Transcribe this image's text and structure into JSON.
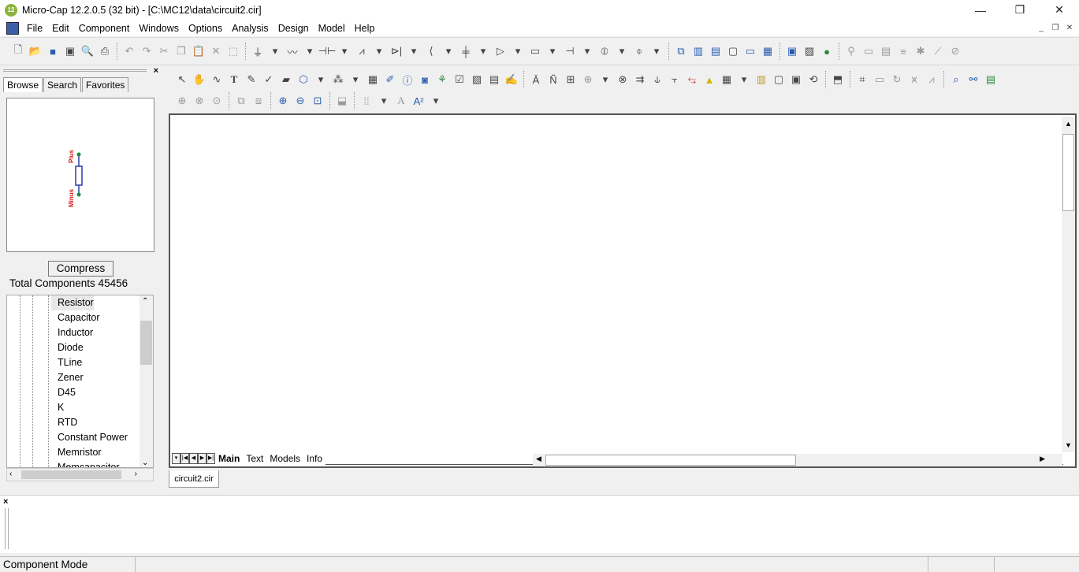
{
  "window": {
    "title": "Micro-Cap 12.2.0.5 (32 bit) - [C:\\MC12\\data\\circuit2.cir]",
    "app_icon_text": "12",
    "minimize": "—",
    "restore": "❐",
    "close": "✕"
  },
  "menu": {
    "items": [
      "File",
      "Edit",
      "Component",
      "Windows",
      "Options",
      "Analysis",
      "Design",
      "Model",
      "Help"
    ],
    "mdi_minimize": "_",
    "mdi_restore": "❐",
    "mdi_close": "✕"
  },
  "left_panel": {
    "close": "×",
    "tabs": [
      "Browse",
      "Search",
      "Favorites"
    ],
    "preview": {
      "pin_top": "Plus",
      "pin_bottom": "Minus"
    },
    "compress_label": "Compress",
    "total_components": "Total Components 45456",
    "tree_items": [
      "Resistor",
      "Capacitor",
      "Inductor",
      "Diode",
      "TLine",
      "Zener",
      "D45",
      "K",
      "RTD",
      "Constant Power",
      "Memristor",
      "Memcapacitor"
    ]
  },
  "workspace": {
    "page_tabs": [
      "Main",
      "Text",
      "Models",
      "Info"
    ],
    "active_page": "Main"
  },
  "doc_tab": "circuit2.cir",
  "output": {
    "close": "×"
  },
  "status": {
    "mode": "Component Mode"
  },
  "colors": {
    "pin_label": "#d11f1f",
    "pin_dot": "#1e8a3a",
    "resistor_body": "#2b3fa8"
  }
}
